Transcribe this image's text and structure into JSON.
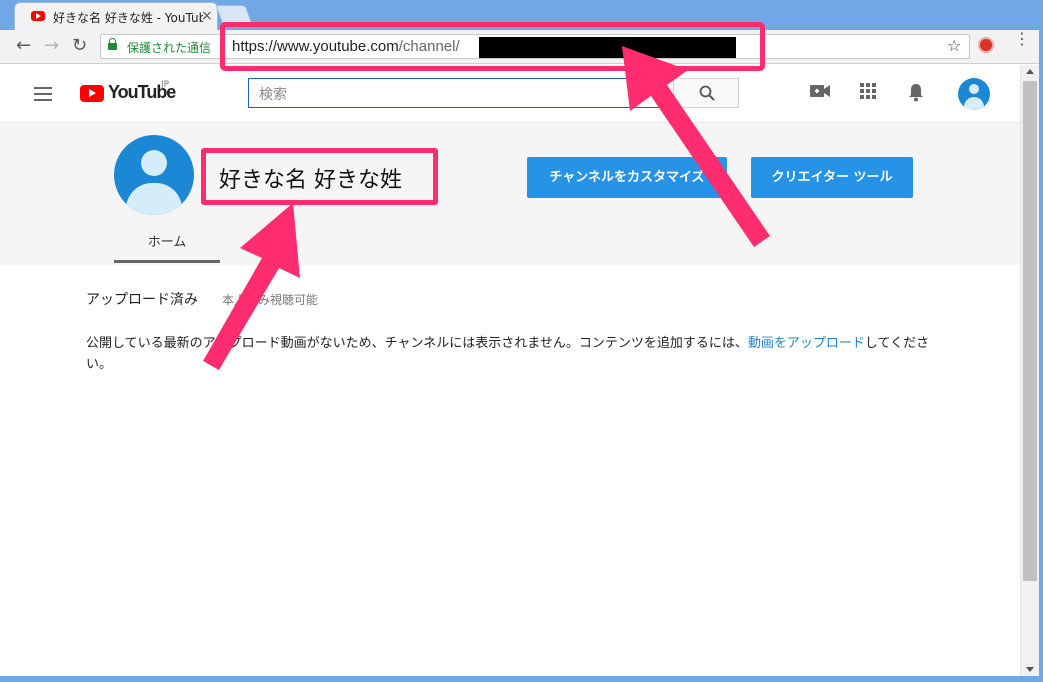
{
  "browser": {
    "tab_title": "好きな名 好きな姓 - YouTube",
    "tab_close": "×",
    "secure_label": "保護された通信",
    "url_host": "https://www.youtube.com",
    "url_path": "/channel/",
    "nav": {
      "back": "←",
      "forward": "→",
      "reload": "↻"
    },
    "star": "☆",
    "menu": "⋮"
  },
  "youtube_header": {
    "logo_text": "YouTube",
    "region": "JP",
    "search_placeholder": "検索"
  },
  "channel": {
    "name": "好きな名 好きな姓",
    "customize_button": "チャンネルをカスタマイズ",
    "creator_tools_button": "クリエイター ツール",
    "tabs": [
      {
        "label": "ホーム"
      }
    ]
  },
  "content": {
    "section_title": "アップロード済み",
    "section_sub": "本人のみ視聴可能",
    "empty_message_before": "公開している最新のアップロード動画がないため、チャンネルには表示されません。コンテンツを追加するには、",
    "empty_message_link": "動画をアップロード",
    "empty_message_after": "してください。"
  },
  "colors": {
    "annotation": "#ff2d6f",
    "button_blue": "#2793e6",
    "youtube_red": "#ff0000",
    "link_blue": "#2781c6"
  },
  "icons": [
    "hamburger-icon",
    "search-icon",
    "video-camera-icon",
    "apps-grid-icon",
    "bell-icon",
    "account-avatar-icon",
    "lock-icon",
    "star-icon"
  ]
}
